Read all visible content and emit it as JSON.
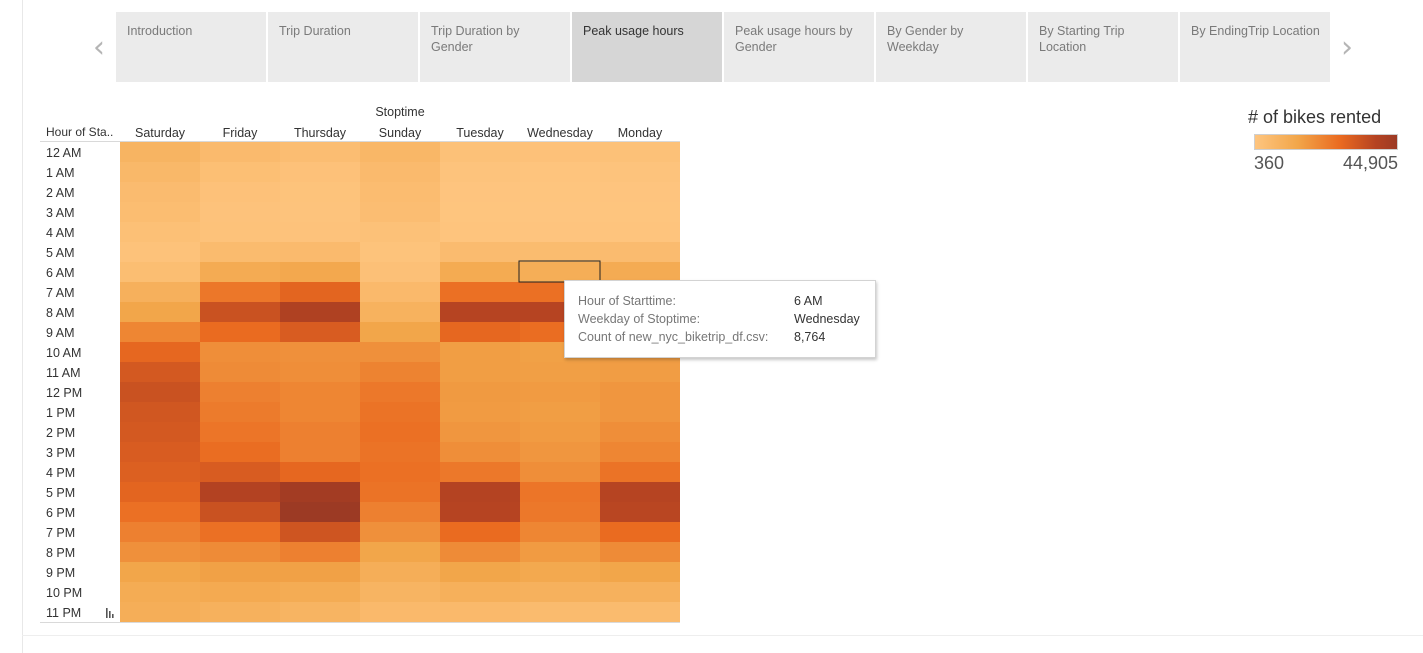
{
  "story": {
    "tabs": [
      {
        "label": "Introduction",
        "active": false
      },
      {
        "label": "Trip Duration",
        "active": false
      },
      {
        "label": "Trip Duration by Gender",
        "active": false
      },
      {
        "label": "Peak usage hours",
        "active": true
      },
      {
        "label": "Peak usage hours by Gender",
        "active": false
      },
      {
        "label": "By Gender by Weekday",
        "active": false
      },
      {
        "label": "By Starting Trip Location",
        "active": false
      },
      {
        "label": "By EndingTrip Location",
        "active": false
      }
    ],
    "prev_icon": "chevron-left-icon",
    "next_icon": "chevron-right-icon"
  },
  "legend": {
    "title": "# of bikes rented",
    "min_label": "360",
    "max_label": "44,905",
    "color_stops": [
      "#fec57f",
      "#f2a64a",
      "#ea6a20",
      "#b54322",
      "#9c3a24"
    ]
  },
  "tooltip": {
    "rows": [
      {
        "label": "Hour of Starttime:",
        "value": "6 AM"
      },
      {
        "label": "Weekday of Stoptime:",
        "value": "Wednesday"
      },
      {
        "label": "Count of new_nyc_biketrip_df.csv:",
        "value": "8,764"
      }
    ]
  },
  "chart_data": {
    "type": "heatmap",
    "title": "",
    "column_group_label": "Stoptime",
    "row_header": "Hour of Sta..",
    "row_header_icon": "sort-icon",
    "columns": [
      "Saturday",
      "Friday",
      "Thursday",
      "Sunday",
      "Tuesday",
      "Wednesday",
      "Monday"
    ],
    "rows": [
      "12 AM",
      "1 AM",
      "2 AM",
      "3 AM",
      "4 AM",
      "5 AM",
      "6 AM",
      "7 AM",
      "8 AM",
      "9 AM",
      "10 AM",
      "11 AM",
      "12 PM",
      "1 PM",
      "2 PM",
      "3 PM",
      "4 PM",
      "5 PM",
      "6 PM",
      "7 PM",
      "8 PM",
      "9 PM",
      "10 PM",
      "11 PM"
    ],
    "value_range": [
      360,
      44905
    ],
    "highlight": {
      "row": "6 AM",
      "column": "Wednesday",
      "value": 8764
    },
    "values": [
      [
        6500,
        4200,
        3100,
        5300,
        1900,
        1700,
        1900
      ],
      [
        4900,
        2600,
        1700,
        4200,
        900,
        800,
        900
      ],
      [
        3800,
        1700,
        1100,
        3500,
        600,
        500,
        600
      ],
      [
        3200,
        1300,
        900,
        3100,
        500,
        450,
        500
      ],
      [
        2200,
        1500,
        1300,
        1900,
        700,
        650,
        700
      ],
      [
        1500,
        3900,
        4200,
        1200,
        3800,
        3700,
        3800
      ],
      [
        3000,
        9700,
        10700,
        2000,
        9800,
        8764,
        9600
      ],
      [
        7800,
        20200,
        24000,
        4500,
        21500,
        21500,
        20500
      ],
      [
        11500,
        29600,
        36500,
        7300,
        33500,
        33500,
        30500
      ],
      [
        17500,
        22500,
        26500,
        11500,
        23500,
        22000,
        21500
      ],
      [
        23500,
        16000,
        15500,
        15500,
        13000,
        12500,
        13000
      ],
      [
        27500,
        16500,
        16000,
        18000,
        13000,
        12800,
        13200
      ],
      [
        29500,
        18500,
        17500,
        20000,
        13800,
        13500,
        14500
      ],
      [
        28000,
        19500,
        17500,
        21000,
        13500,
        13000,
        14500
      ],
      [
        27500,
        20500,
        18500,
        21500,
        14500,
        13500,
        16000
      ],
      [
        26500,
        22000,
        18500,
        21000,
        16000,
        14500,
        17500
      ],
      [
        25500,
        26500,
        23500,
        21500,
        20000,
        16000,
        21000
      ],
      [
        24000,
        34500,
        42000,
        21000,
        34000,
        20500,
        33500
      ],
      [
        21500,
        29500,
        44905,
        18500,
        33500,
        20000,
        33000
      ],
      [
        18500,
        21500,
        28500,
        15500,
        22500,
        17500,
        22500
      ],
      [
        15500,
        16500,
        18500,
        11500,
        16500,
        13500,
        16500
      ],
      [
        11500,
        12500,
        12500,
        8500,
        11500,
        10500,
        11500
      ],
      [
        9500,
        10000,
        9500,
        6500,
        8000,
        7500,
        7500
      ],
      [
        8500,
        7500,
        6500,
        4500,
        4500,
        4000,
        4000
      ]
    ]
  }
}
